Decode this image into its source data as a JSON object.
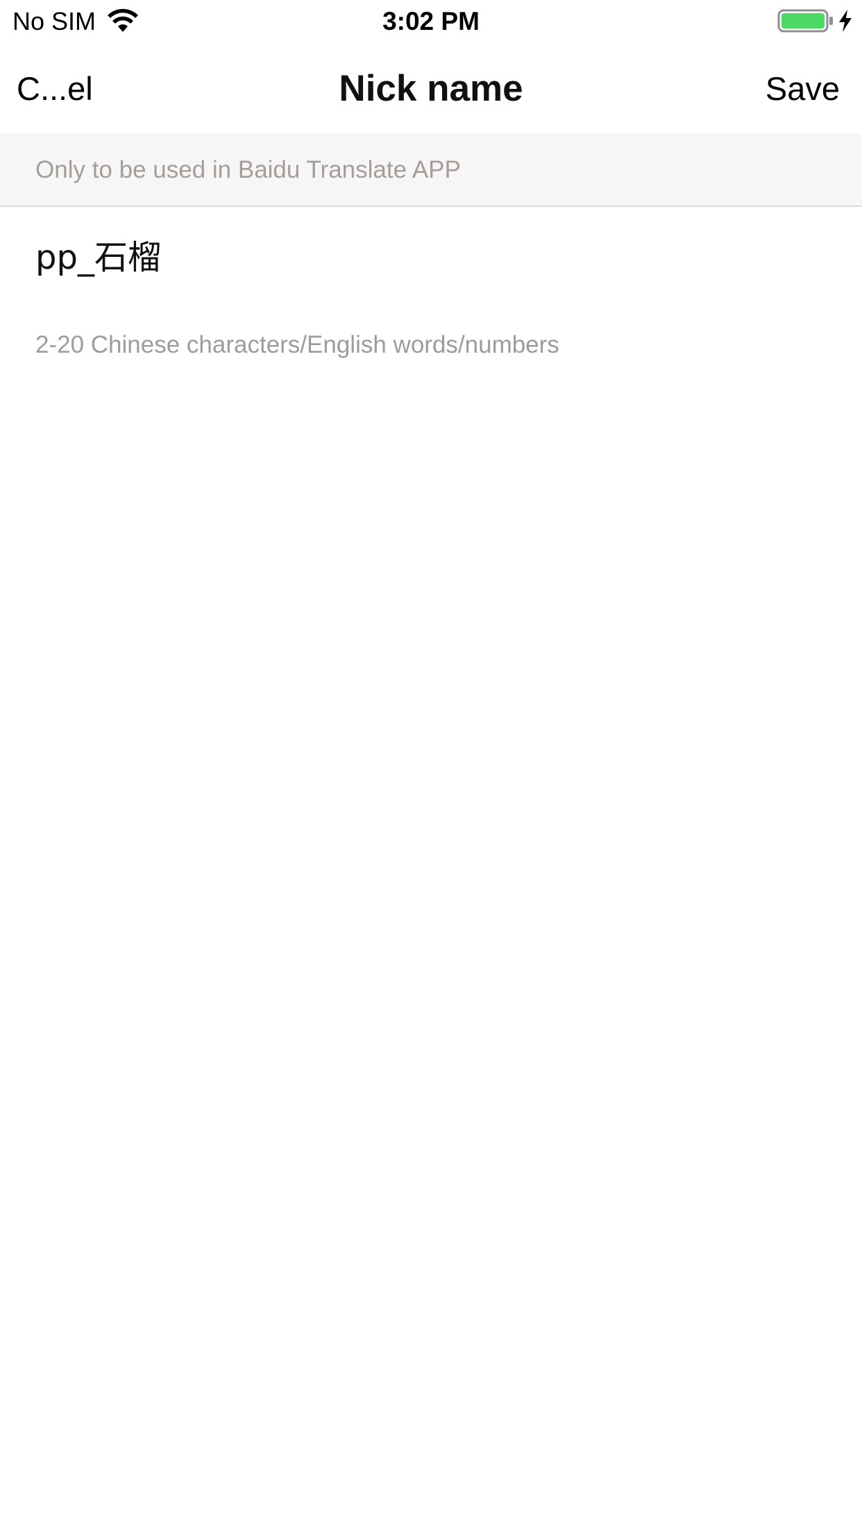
{
  "status_bar": {
    "carrier": "No SIM",
    "time": "3:02 PM",
    "wifi_icon": "wifi-icon",
    "battery_icon": "battery-icon",
    "charging_icon": "charging-bolt-icon",
    "battery_color": "#4cd964"
  },
  "nav": {
    "cancel_label": "C...el",
    "title": "Nick name",
    "save_label": "Save"
  },
  "notice": {
    "text": "Only to be used in Baidu Translate APP"
  },
  "form": {
    "nickname_value": "pp_石榴",
    "hint": "2-20 Chinese characters/English words/numbers"
  },
  "colors": {
    "notice_background": "#f6f6f6",
    "notice_text": "#a69c98",
    "hint_text": "#9c9c9c"
  }
}
